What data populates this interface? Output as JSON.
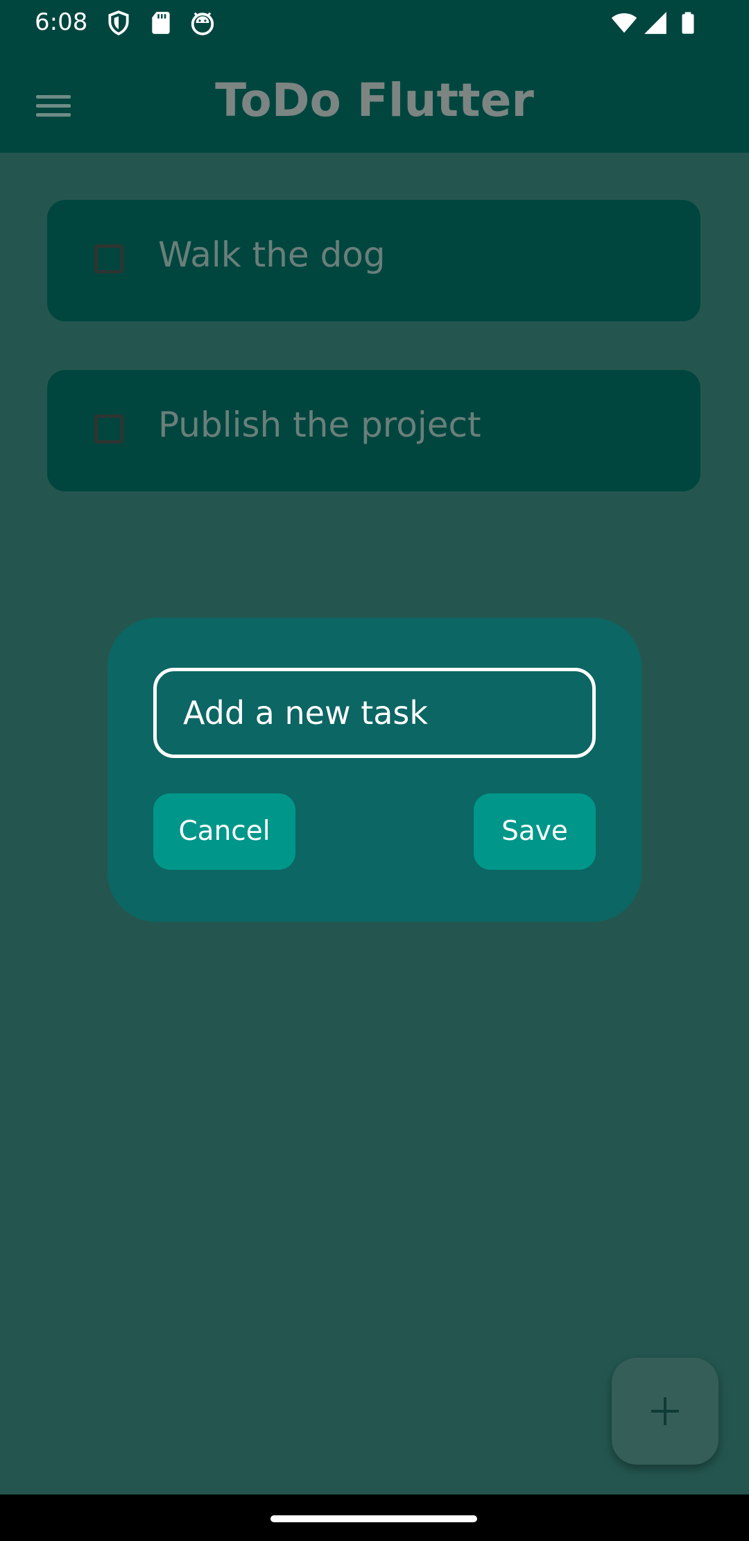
{
  "status_bar": {
    "time": "6:08",
    "icons": [
      "shield-icon",
      "sd-card-icon",
      "android-debug-icon",
      "wifi-icon",
      "signal-icon",
      "battery-icon"
    ]
  },
  "app_bar": {
    "title": "ToDo Flutter",
    "menu_icon": "hamburger-menu-icon"
  },
  "tasks": [
    {
      "label": "Walk the dog",
      "checked": false
    },
    {
      "label": "Publish the project",
      "checked": false
    }
  ],
  "dialog": {
    "input_placeholder": "Add a new task",
    "input_value": "",
    "cancel_label": "Cancel",
    "save_label": "Save"
  },
  "fab": {
    "icon": "plus-icon"
  },
  "colors": {
    "app_bar": "#00463f",
    "background_scrim": "#24564f",
    "task_card": "#00463f",
    "dialog": "#0c6663",
    "button": "#00978a",
    "fab": "#355e58"
  }
}
